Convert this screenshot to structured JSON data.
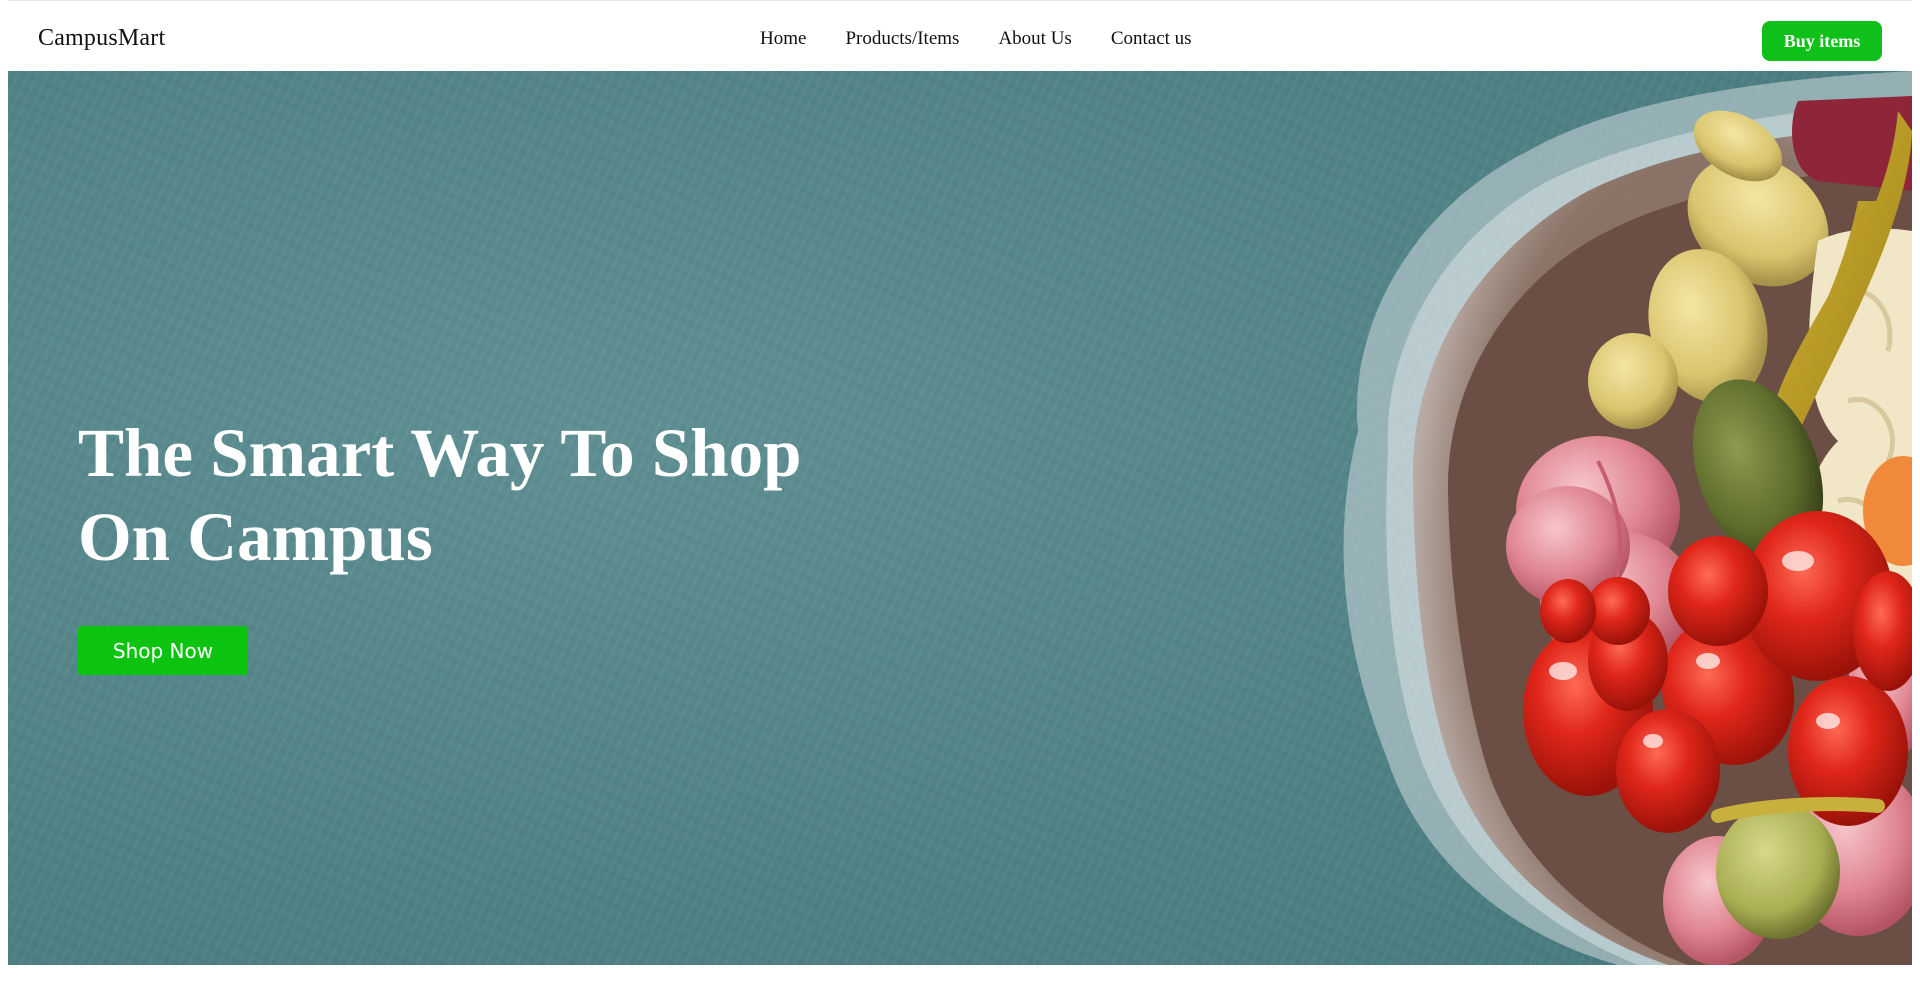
{
  "navbar": {
    "brand": "CampusMart",
    "links": [
      "Home",
      "Products/Items",
      "About Us",
      "Contact us"
    ],
    "cta_label": "Buy items"
  },
  "hero": {
    "title": "The Smart Way To Shop On Campus",
    "button_label": "Shop Now",
    "image_subject": "bowl-of-pickled-vegetables"
  },
  "colors": {
    "accent_green": "#0fbf1a",
    "hero_teal": "#53868a",
    "text_dark": "#111111",
    "text_light": "#ffffff"
  }
}
